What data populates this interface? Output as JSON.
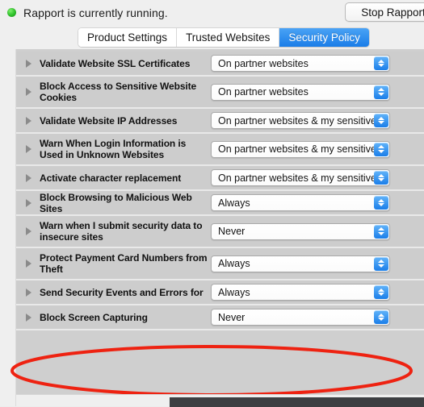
{
  "status": {
    "indicator": "green-status-dot",
    "message": "Rapport is currently running.",
    "stop_button_label": "Stop Rapport"
  },
  "tabs": [
    {
      "label": "Product Settings",
      "active": false
    },
    {
      "label": "Trusted Websites",
      "active": false
    },
    {
      "label": "Security Policy",
      "active": true
    }
  ],
  "settings": [
    {
      "label": "Validate Website SSL Certificates",
      "value": "On partner websites",
      "lines": 1
    },
    {
      "label": "Block Access to Sensitive Website Cookies",
      "value": "On partner websites",
      "lines": 2
    },
    {
      "label": "Validate Website IP Addresses",
      "value": "On partner websites & my sensitive w...",
      "lines": 1
    },
    {
      "label": "Warn When Login Information is Used in Unknown Websites",
      "value": "On partner websites & my sensitive w...",
      "lines": 2
    },
    {
      "label": "Activate character replacement",
      "value": "On partner websites & my sensitive w...",
      "lines": 1
    },
    {
      "label": "Block Browsing to Malicious Web Sites",
      "value": "Always",
      "lines": 1
    },
    {
      "label": "Warn when I submit security data to insecure sites",
      "value": "Never",
      "lines": 2
    },
    {
      "label": "Protect Payment Card Numbers from Theft",
      "value": "Always",
      "lines": 2
    },
    {
      "label": "Send Security Events and Errors for",
      "value": "Always",
      "lines": 1
    },
    {
      "label": "Block Screen Capturing",
      "value": "Never",
      "lines": 1
    }
  ],
  "annotation": {
    "shape": "ellipse",
    "color": "#ee2211",
    "target_label": "Block Screen Capturing"
  },
  "colors": {
    "accent_blue": "#1a7de8",
    "status_green": "#2ec02a",
    "annotation_red": "#ee2211",
    "panel_gray": "#cdcdcd"
  }
}
